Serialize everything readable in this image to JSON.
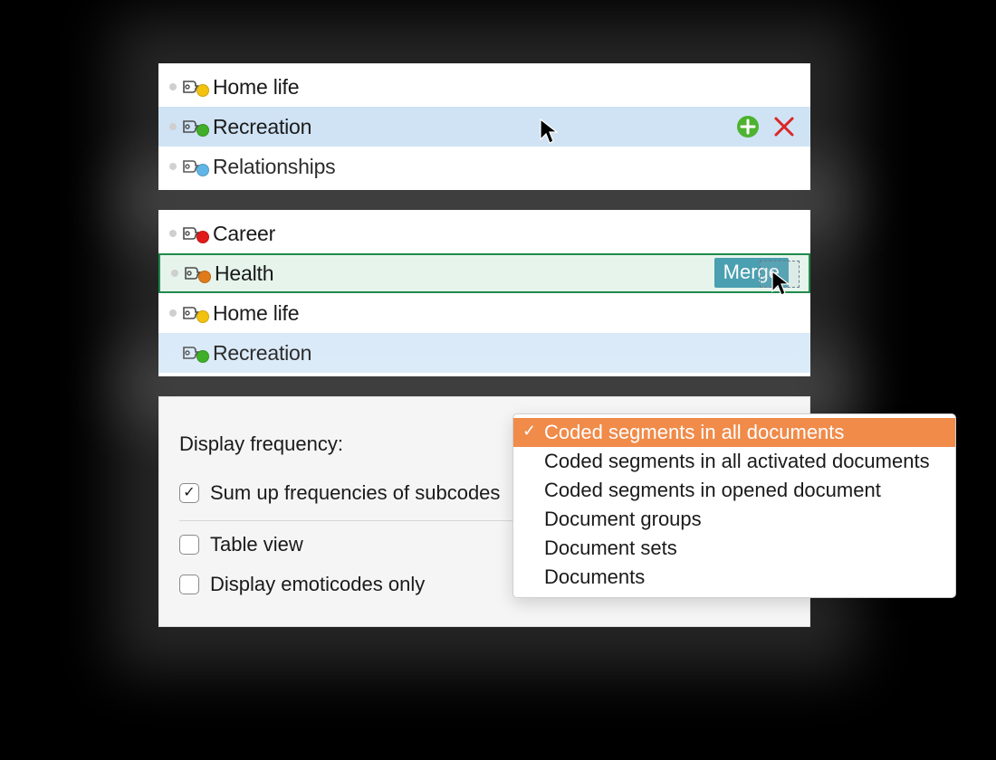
{
  "panel1": {
    "items": [
      {
        "label": "Home life",
        "color": "#f2c20f"
      },
      {
        "label": "Recreation",
        "color": "#3fae29"
      },
      {
        "label": "Relationships",
        "color": "#5fb6e6"
      }
    ]
  },
  "panel2": {
    "items": [
      {
        "label": "Career",
        "color": "#e11a1a"
      },
      {
        "label": "Health",
        "color": "#e07b1a"
      },
      {
        "label": "Home life",
        "color": "#f2c20f"
      },
      {
        "label": "Recreation",
        "color": "#3fae29"
      }
    ],
    "merge_label": "Merge"
  },
  "options": {
    "display_frequency_label": "Display frequency:",
    "sum_up": "Sum up frequencies of subcodes",
    "table_view": "Table view",
    "emoticodes": "Display emoticodes only"
  },
  "dropdown": {
    "items": [
      "Coded segments in all documents",
      "Coded segments in all activated documents",
      "Coded segments in opened document",
      "Document groups",
      "Document sets",
      "Documents"
    ],
    "selected_index": 0
  }
}
